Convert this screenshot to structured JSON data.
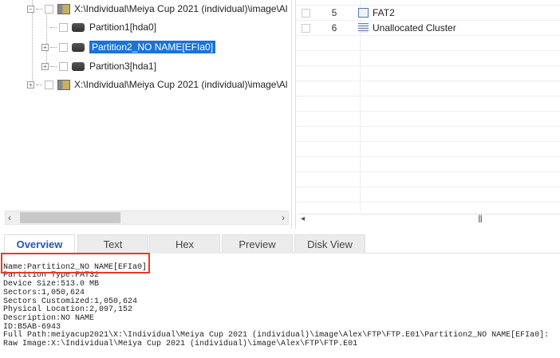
{
  "tree": {
    "items": [
      {
        "label": "X:\\Individual\\Meiya Cup 2021 (individual)\\image\\Al",
        "toggle": "−",
        "icon": "disk-image-icon"
      },
      {
        "label": "Partition1[hda0]",
        "toggle": "",
        "icon": "partition-icon"
      },
      {
        "label": "Partition2_NO NAME[EFIa0]",
        "toggle": "+",
        "icon": "partition-icon",
        "selected": true
      },
      {
        "label": "Partition3[hda1]",
        "toggle": "+",
        "icon": "partition-icon"
      },
      {
        "label": "X:\\Individual\\Meiya Cup 2021 (individual)\\image\\Al",
        "toggle": "+",
        "icon": "disk-image-icon"
      }
    ]
  },
  "list": {
    "rows": [
      {
        "num": "5",
        "name": "FAT2"
      },
      {
        "num": "6",
        "name": "Unallocated Cluster"
      }
    ]
  },
  "tabs": [
    "Overview",
    "Text",
    "Hex",
    "Preview",
    "Disk View"
  ],
  "details": [
    "Name:Partition2_NO NAME[EFIa0]",
    "Partition Type:FAT32",
    "Device Size:513.0 MB",
    "Sectors:1,050,624",
    "Sectors Customized:1,050,624",
    "Physical Location:2,097,152",
    "Description:NO NAME",
    "ID:B5AB-6943",
    "Full Path:meiyacup2021\\X:\\Individual\\Meiya Cup 2021 (individual)\\image\\Alex\\FTP\\FTP.E01\\Partition2_NO NAME[EFIa0]:",
    "Raw Image:X:\\Individual\\Meiya Cup 2021 (individual)\\image\\Alex\\FTP\\FTP.E01"
  ],
  "colors": {
    "selection": "#1a73d9",
    "active_tab": "#2456b8",
    "highlight_box": "#e53a2b"
  }
}
